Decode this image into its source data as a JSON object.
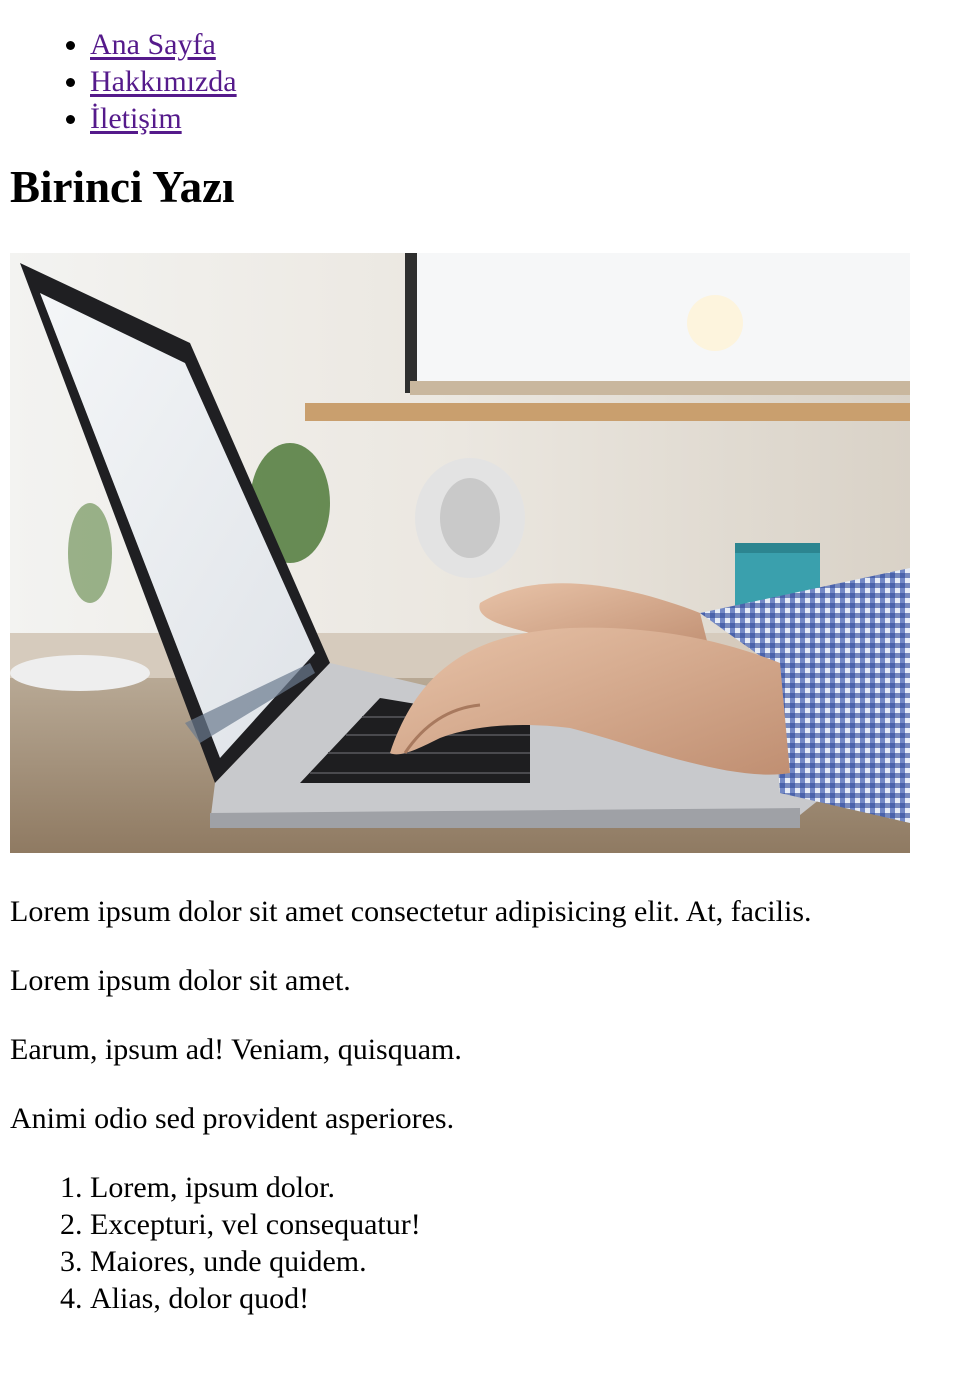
{
  "nav": {
    "items": [
      {
        "label": "Ana Sayfa"
      },
      {
        "label": "Hakkımızda"
      },
      {
        "label": "İletişim"
      }
    ],
    "link_color": "#551a8b"
  },
  "article": {
    "title": "Birinci Yazı",
    "image": {
      "icon": "laptop-typing-photo"
    },
    "paragraphs": [
      "Lorem ipsum dolor sit amet consectetur adipisicing elit. At, facilis.",
      "Lorem ipsum dolor sit amet.",
      "Earum, ipsum ad! Veniam, quisquam.",
      "Animi odio sed provident asperiores."
    ],
    "list": [
      "Lorem, ipsum dolor.",
      "Excepturi, vel consequatur!",
      "Maiores, unde quidem.",
      "Alias, dolor quod!"
    ]
  }
}
